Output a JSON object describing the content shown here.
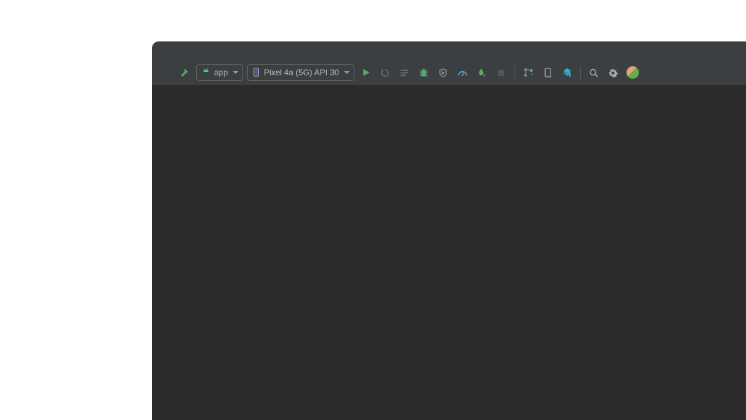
{
  "toolbar": {
    "module_selector": {
      "label": "app"
    },
    "device_selector": {
      "label": "Pixel 4a (5G) API 30"
    }
  },
  "icons": {
    "hammer": "build-icon",
    "android": "android-icon",
    "phone": "phone-icon",
    "run": "run-icon",
    "rerun": "apply-changes-icon",
    "stack": "apply-code-changes-icon",
    "bug": "debug-icon",
    "coverage": "coverage-icon",
    "profiler": "profiler-icon",
    "attach": "attach-debugger-icon",
    "stop": "stop-icon",
    "gitbranch": "git-branch-icon",
    "devices": "device-manager-icon",
    "sync": "sync-project-icon",
    "search": "search-icon",
    "settings": "settings-icon",
    "user": "user-avatar"
  }
}
